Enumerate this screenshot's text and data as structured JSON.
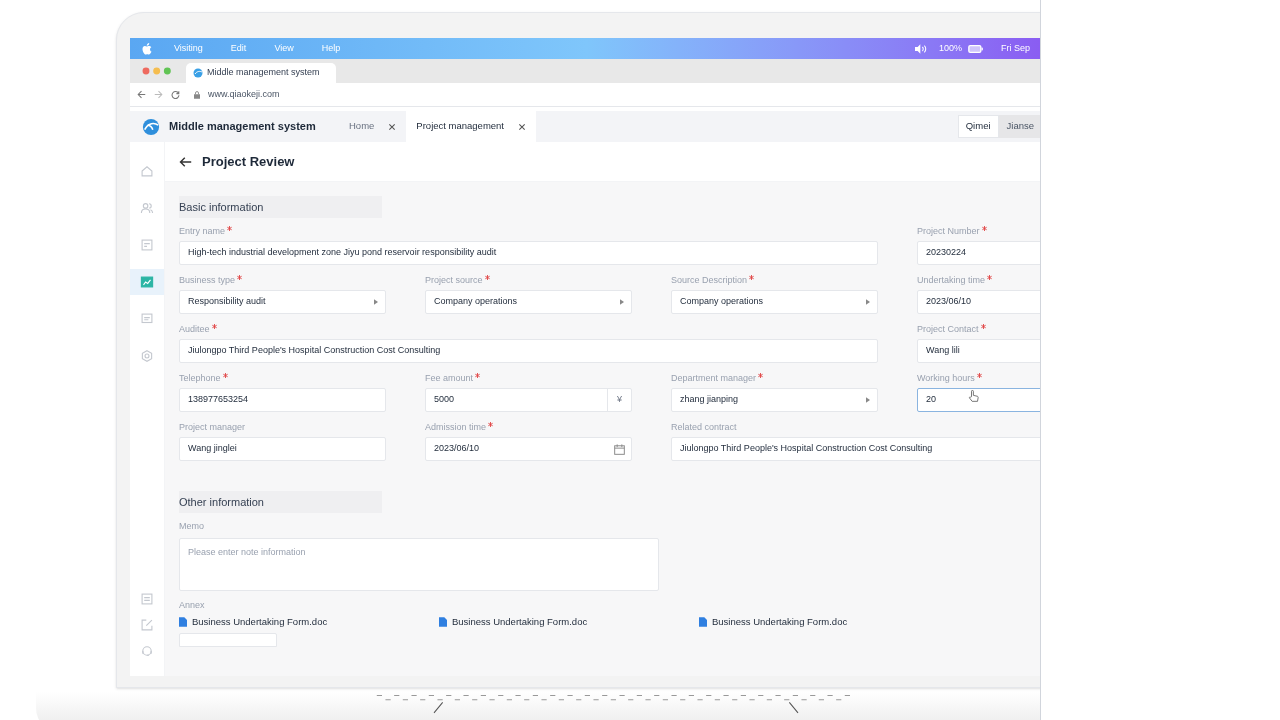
{
  "menu_bar": {
    "items": [
      "Visiting",
      "Edit",
      "View",
      "Help"
    ],
    "battery": "100%",
    "clock": "Fri Sep"
  },
  "browser": {
    "tab_title": "Middle management system",
    "url": "www.qiaokeji.com"
  },
  "app": {
    "title": "Middle management system",
    "tabs": [
      {
        "label": "Home",
        "selected": false
      },
      {
        "label": "Project management",
        "selected": true
      }
    ],
    "users": [
      {
        "label": "Qimei",
        "selected": true
      },
      {
        "label": "Jianse",
        "selected": false
      }
    ]
  },
  "sidebar": {
    "items": [
      {
        "kind": "home",
        "selected": false
      },
      {
        "kind": "users",
        "selected": false
      },
      {
        "kind": "report",
        "selected": false
      },
      {
        "kind": "chart",
        "selected": true
      },
      {
        "kind": "message",
        "selected": false
      },
      {
        "kind": "settings",
        "selected": false
      }
    ],
    "bottom_items": [
      {
        "kind": "document",
        "selected": false
      },
      {
        "kind": "edit",
        "selected": false
      },
      {
        "kind": "support",
        "selected": false
      }
    ]
  },
  "page_title": "Project Review",
  "basic_information": {
    "title": "Basic information",
    "rows": [
      [
        {
          "label": "Entry name",
          "required": true,
          "kind": "text",
          "value": "High-tech industrial development zone Jiyu pond reservoir responsibility audit"
        },
        {
          "label": "Project Number ",
          "required": true,
          "kind": "text",
          "value": "20230224"
        }
      ],
      [
        {
          "label": "Business type",
          "required": true,
          "kind": "select",
          "value": "Responsibility audit"
        },
        {
          "label": "Project source",
          "required": true,
          "kind": "select",
          "value": "Company operations"
        },
        {
          "label": "Source Description",
          "required": true,
          "kind": "select",
          "value": "Company operations"
        },
        {
          "label": "Undertaking time",
          "required": true,
          "kind": "text",
          "value": "2023/06/10"
        }
      ],
      [
        {
          "label": "Auditee",
          "required": true,
          "kind": "text",
          "value": "Jiulongpo Third People's Hospital Construction Cost Consulting"
        },
        {
          "label": "Project Contact",
          "required": true,
          "kind": "text",
          "value": "Wang lili"
        }
      ],
      [
        {
          "label": "Telephone",
          "required": true,
          "kind": "text",
          "value": "138977653254"
        },
        {
          "label": "Fee amount",
          "required": true,
          "kind": "currency",
          "value": "5000",
          "suffix": "¥"
        },
        {
          "label": "Department manager",
          "required": true,
          "kind": "select",
          "value": "zhang jianping"
        },
        {
          "label": "Working hours",
          "required": true,
          "kind": "text",
          "value": "20",
          "focused": true
        }
      ],
      [
        {
          "label": "Project manager",
          "required": false,
          "kind": "text",
          "value": "Wang jinglei"
        },
        {
          "label": "Admission time",
          "required": true,
          "kind": "date",
          "value": "2023/06/10"
        },
        {
          "label": "Related contract",
          "required": false,
          "kind": "text",
          "value": "Jiulongpo Third People's Hospital Construction Cost Consulting"
        }
      ]
    ]
  },
  "other_information": {
    "title": "Other information",
    "memo": {
      "label": "Memo",
      "placeholder": "Please enter note information"
    },
    "annex": {
      "label": "Annex",
      "files": [
        "Business Undertaking Form.doc",
        "Business Undertaking Form.doc",
        "Business Undertaking Form.doc"
      ]
    }
  }
}
